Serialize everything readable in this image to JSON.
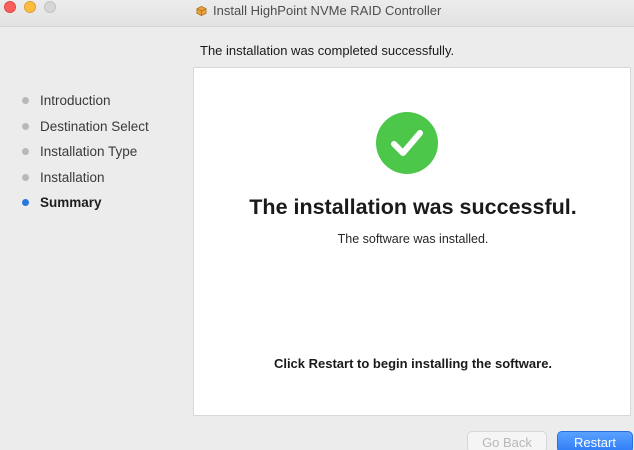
{
  "window": {
    "title": "Install HighPoint NVMe RAID Controller",
    "icon": "package-icon"
  },
  "header": {
    "text": "The installation was completed successfully."
  },
  "sidebar": {
    "items": [
      {
        "label": "Introduction",
        "active": false
      },
      {
        "label": "Destination Select",
        "active": false
      },
      {
        "label": "Installation Type",
        "active": false
      },
      {
        "label": "Installation",
        "active": false
      },
      {
        "label": "Summary",
        "active": true
      }
    ]
  },
  "main": {
    "status_icon": "success-check-icon",
    "title": "The installation was successful.",
    "subtitle": "The software was installed.",
    "note": "Click Restart to begin installing the software."
  },
  "buttons": {
    "back_label": "Go Back",
    "restart_label": "Restart"
  },
  "colors": {
    "success": "#4cc74a",
    "accent": "#2f7bf5",
    "active_step": "#2b78dc"
  }
}
